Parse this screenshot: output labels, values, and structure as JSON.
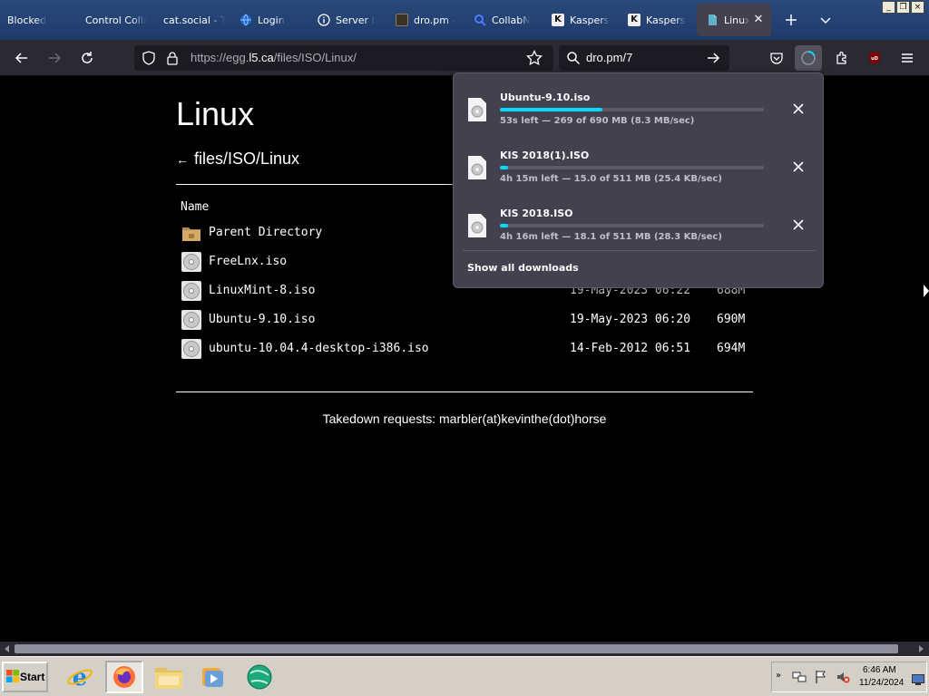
{
  "browser": {
    "tabs": [
      {
        "label": "Blocked",
        "favicon": "none"
      },
      {
        "label": "Control Colla",
        "favicon": "none"
      },
      {
        "label": "cat.social - T",
        "favicon": "none"
      },
      {
        "label": "Login",
        "favicon": "globe-icon"
      },
      {
        "label": "Server I",
        "favicon": "info-icon"
      },
      {
        "label": "dro.pm -",
        "favicon": "page-thumb-icon"
      },
      {
        "label": "CollabN",
        "favicon": "search-icon"
      },
      {
        "label": "Kaspers",
        "favicon": "kaspersky-icon"
      },
      {
        "label": "Kaspers",
        "favicon": "kaspersky-icon"
      },
      {
        "label": "Linux",
        "favicon": "file-icon"
      }
    ],
    "active_tab_index": 9,
    "window_buttons": [
      "_",
      "❐",
      "×"
    ],
    "url": {
      "prefix": "https://egg.",
      "domain": "l5.ca",
      "path": "/files/ISO/Linux/"
    },
    "search_text": "dro.pm/7",
    "accent_color": "#00ddff"
  },
  "page": {
    "title": "Linux",
    "breadcrumb_arrow": "←",
    "breadcrumb": "files/ISO/Linux",
    "column_name": "Name",
    "rows": [
      {
        "icon": "folder-icon",
        "name": "Parent Directory",
        "date": "",
        "size": ""
      },
      {
        "icon": "disc-icon",
        "name": "FreeLnx.iso",
        "date": "",
        "size": ""
      },
      {
        "icon": "disc-icon",
        "name": "LinuxMint-8.iso",
        "date": "19-May-2023 06:22",
        "size": "688M"
      },
      {
        "icon": "disc-icon",
        "name": "Ubuntu-9.10.iso",
        "date": "19-May-2023 06:20",
        "size": "690M"
      },
      {
        "icon": "disc-icon",
        "name": "ubuntu-10.04.4-desktop-i386.iso",
        "date": "14-Feb-2012 06:51",
        "size": "694M"
      }
    ],
    "footer": "Takedown requests: marbler(at)kevinthe(dot)horse"
  },
  "downloads": {
    "items": [
      {
        "name": "Ubuntu-9.10.iso",
        "progress": 0.39,
        "status": "53s left — 269 of 690 MB (8.3 MB/sec)"
      },
      {
        "name": "KIS 2018(1).ISO",
        "progress": 0.03,
        "status": "4h 15m left — 15.0 of 511 MB (25.4 KB/sec)"
      },
      {
        "name": "KIS 2018.ISO",
        "progress": 0.03,
        "status": "4h 16m left — 18.1 of 511 MB (28.3 KB/sec)"
      }
    ],
    "show_all": "Show all downloads"
  },
  "taskbar": {
    "start_label": "Start",
    "apps": [
      "internet-explorer-icon",
      "firefox-icon",
      "file-explorer-icon",
      "media-player-icon",
      "globe-app-icon"
    ],
    "time": "6:46 AM",
    "date": "11/24/2024"
  }
}
